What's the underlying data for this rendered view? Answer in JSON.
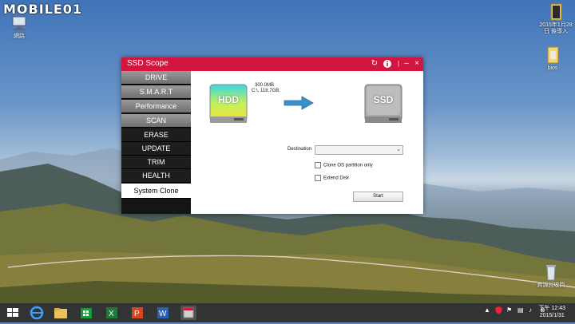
{
  "watermark": "MOBILE01",
  "desktop": {
    "icons": [
      {
        "name": "network-icon",
        "label": "網路"
      },
      {
        "name": "folder-icon",
        "label": "2015年1月28日 後導入"
      },
      {
        "name": "folder-icon",
        "label": "bios"
      },
      {
        "name": "recycle-bin-icon",
        "label": "資源回收筒"
      }
    ]
  },
  "app": {
    "title": "SSD Scope",
    "nav": [
      {
        "label": "DRIVE",
        "state": "grey"
      },
      {
        "label": "S.M.A.R.T",
        "state": "grey"
      },
      {
        "label": "Performance",
        "state": "grey"
      },
      {
        "label": "SCAN",
        "state": "grey"
      },
      {
        "label": "ERASE",
        "state": "dark"
      },
      {
        "label": "UPDATE",
        "state": "dark"
      },
      {
        "label": "TRIM",
        "state": "dark"
      },
      {
        "label": "HEALTH",
        "state": "dark"
      },
      {
        "label": "System Clone",
        "state": "active"
      }
    ],
    "source_drive": {
      "label": "HDD",
      "line1": "300.0MB",
      "line2": "C:\\, 118.7GB."
    },
    "target_drive": {
      "label": "SSD"
    },
    "destination_label": "Destination",
    "destination_value": "",
    "clone_os_label": "Clone OS partition only",
    "extend_disk_label": "Extend Disk",
    "start_label": "Start"
  },
  "taskbar": {
    "clock_time": "下午 12:43",
    "clock_date": "2015/1/31"
  },
  "colors": {
    "titlebar": "#d2163f",
    "sidebar": "#151515",
    "taskbar": "#282837"
  }
}
